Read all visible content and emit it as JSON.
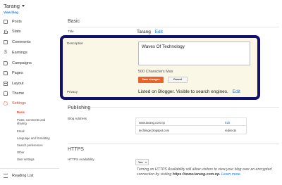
{
  "sidebar": {
    "blog_name": "Tarang",
    "view_blog": "View blog",
    "items": [
      {
        "label": "Posts",
        "icon": "posts-icon"
      },
      {
        "label": "Stats",
        "icon": "stats-icon"
      },
      {
        "label": "Comments",
        "icon": "comments-icon"
      },
      {
        "label": "Earnings",
        "icon": "earnings-icon"
      },
      {
        "label": "Campaigns",
        "icon": "campaigns-icon"
      },
      {
        "label": "Pages",
        "icon": "pages-icon"
      },
      {
        "label": "Layout",
        "icon": "layout-icon"
      },
      {
        "label": "Theme",
        "icon": "theme-icon"
      },
      {
        "label": "Settings",
        "icon": "settings-icon"
      }
    ],
    "settings_subitems": [
      "Basic",
      "Posts, comments and sharing",
      "Email",
      "Language and formatting",
      "Search preferences",
      "Other",
      "User settings"
    ],
    "reading_list": "Reading List"
  },
  "basic": {
    "section_title": "Basic",
    "title_label": "Title",
    "title_value": "Tarang",
    "edit": "Edit",
    "description_label": "Description",
    "description_value": "Waves Of Technology",
    "chars_max": "500 Characters Max",
    "save_button": "Save changes",
    "cancel_button": "Cancel",
    "privacy_label": "Privacy",
    "privacy_value": "Listed on Blogger. Visible to search engines.",
    "privacy_edit": "Edit"
  },
  "publishing": {
    "section_title": "Publishing",
    "blog_address_label": "Blog Address",
    "addresses": [
      {
        "address": "www.tarang.com.np",
        "status": "Edit"
      },
      {
        "address": "techtinge.blogspot.com",
        "status": "redirects"
      }
    ]
  },
  "https": {
    "section_title": "HTTPS",
    "availability_label": "HTTPS Availability",
    "availability_value": "Yes",
    "help_text_1": "Turning on HTTPS Availability will allow visitors to view your blog over an encrypted connection by visiting",
    "help_url": "https://www.tarang.com.np.",
    "learn_more": "Learn more."
  }
}
